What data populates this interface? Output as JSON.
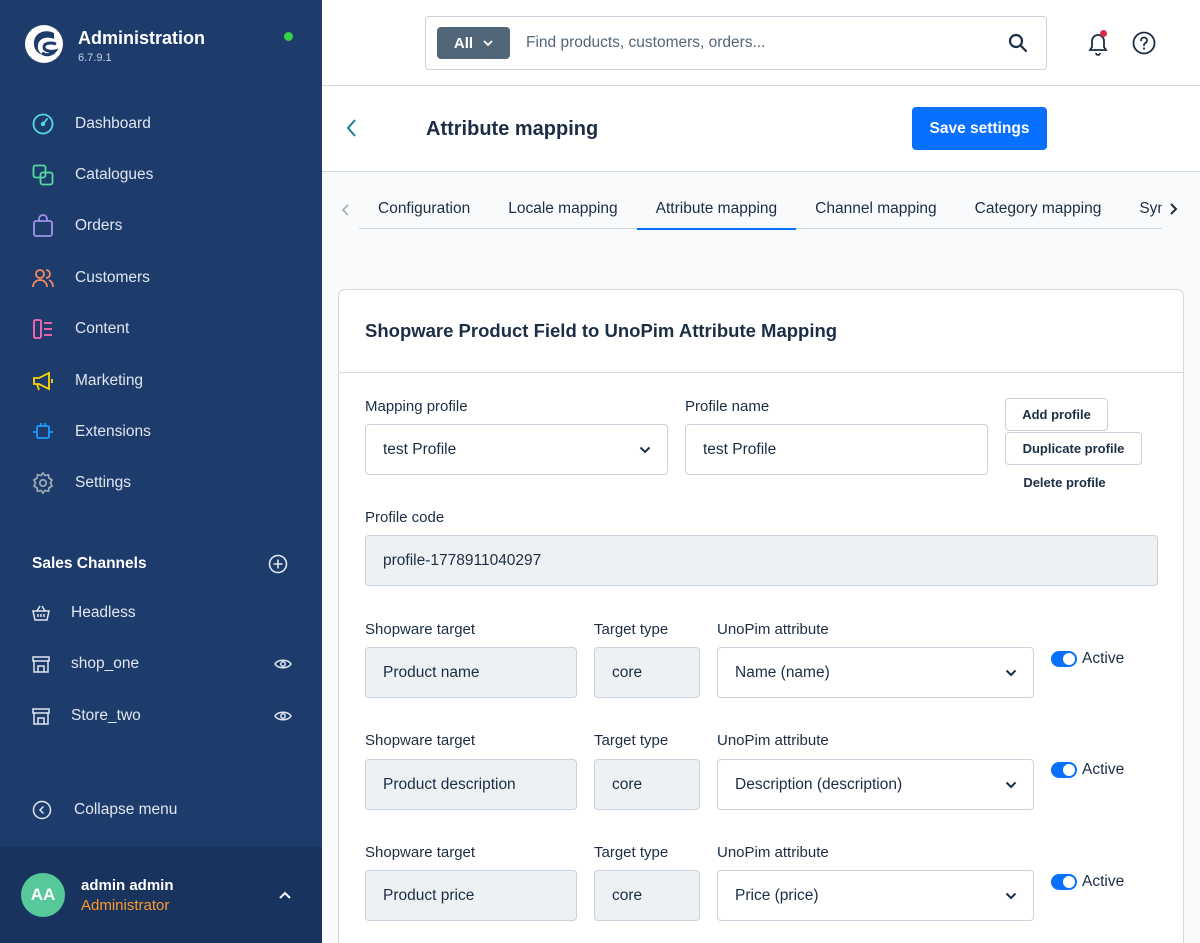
{
  "app": {
    "title": "Administration",
    "version": "6.7.9.1"
  },
  "nav": {
    "items": [
      {
        "label": "Dashboard",
        "icon": "dashboard-icon",
        "color": "#57d9e3"
      },
      {
        "label": "Catalogues",
        "icon": "catalogue-icon",
        "color": "#57d9a3"
      },
      {
        "label": "Orders",
        "icon": "orders-icon",
        "color": "#a092f0"
      },
      {
        "label": "Customers",
        "icon": "customers-icon",
        "color": "#f88962"
      },
      {
        "label": "Content",
        "icon": "content-icon",
        "color": "#ff68b4"
      },
      {
        "label": "Marketing",
        "icon": "marketing-icon",
        "color": "#ffd700"
      },
      {
        "label": "Extensions",
        "icon": "extensions-icon",
        "color": "#189eff"
      },
      {
        "label": "Settings",
        "icon": "settings-icon",
        "color": "#9aa8b5"
      }
    ]
  },
  "sales_channels": {
    "title": "Sales Channels",
    "items": [
      {
        "label": "Headless",
        "icon": "basket-icon",
        "visible_toggle": false
      },
      {
        "label": "shop_one",
        "icon": "storefront-icon",
        "visible_toggle": true
      },
      {
        "label": "Store_two",
        "icon": "storefront-icon",
        "visible_toggle": true
      }
    ]
  },
  "collapse_label": "Collapse menu",
  "user": {
    "initials": "AA",
    "name": "admin admin",
    "role": "Administrator"
  },
  "search": {
    "type_label": "All",
    "placeholder": "Find products, customers, orders..."
  },
  "page": {
    "title": "Attribute mapping",
    "save_label": "Save settings"
  },
  "tabs": {
    "items": [
      "Configuration",
      "Locale mapping",
      "Attribute mapping",
      "Channel mapping",
      "Category mapping",
      "Sync"
    ],
    "active_index": 2
  },
  "card": {
    "title": "Shopware Product Field to UnoPim Attribute Mapping",
    "mapping_profile_label": "Mapping profile",
    "mapping_profile_value": "test Profile",
    "profile_name_label": "Profile name",
    "profile_name_value": "test Profile",
    "add_profile": "Add profile",
    "duplicate_profile": "Duplicate profile",
    "delete_profile": "Delete profile",
    "profile_code_label": "Profile code",
    "profile_code_value": "profile-1778911040297",
    "col_target": "Shopware target",
    "col_type": "Target type",
    "col_attr": "UnoPim attribute",
    "rows": [
      {
        "target": "Product name",
        "type": "core",
        "attribute": "Name (name)",
        "active_label": "Active",
        "active": true
      },
      {
        "target": "Product description",
        "type": "core",
        "attribute": "Description (description)",
        "active_label": "Active",
        "active": true
      },
      {
        "target": "Product price",
        "type": "core",
        "attribute": "Price (price)",
        "active_label": "Active",
        "active": true
      }
    ]
  },
  "colors": {
    "sidebar": "#1e3c6b",
    "accent": "#0870ff",
    "online": "#37d046",
    "role": "#ff9a26"
  }
}
